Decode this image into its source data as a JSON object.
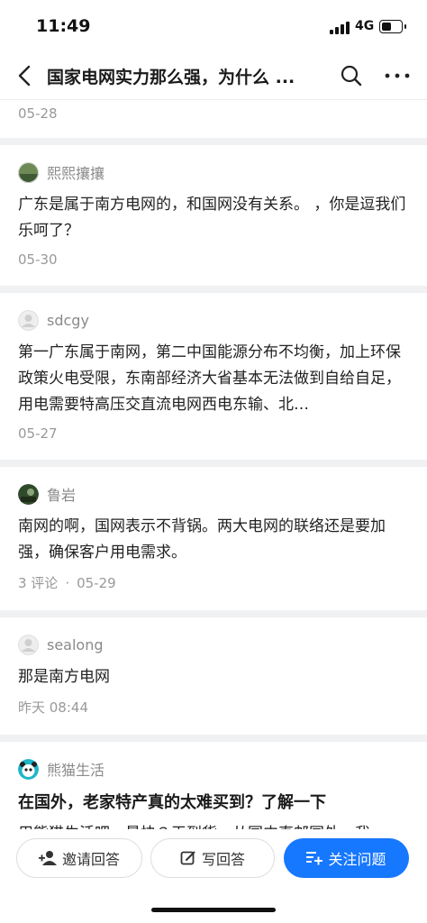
{
  "status": {
    "time": "11:49",
    "network": "4G"
  },
  "nav": {
    "title": "国家电网实力那么强，为什么 ...",
    "icons": [
      "back-arrow-icon",
      "search-icon",
      "more-dots-icon"
    ]
  },
  "answers": [
    {
      "body": "",
      "date": "05-28"
    },
    {
      "user": "熙熙攘攘",
      "body": "广东是属于南方电网的，和国网没有关系。 ，你是逗我们乐呵了？",
      "date": "05-30"
    },
    {
      "user": "sdcgy",
      "body": "第一广东属于南网，第二中国能源分布不均衡，加上环保政策火电受限，东南部经济大省基本无法做到自给自足，用电需要特高压交直流电网西电东输、北…",
      "date": "05-27"
    },
    {
      "user": "鲁岩",
      "body": "南网的啊，国网表示不背锅。两大电网的联络还是要加强，确保客户用电需求。",
      "comments": "3 评论",
      "separator": "·",
      "date": "05-29"
    },
    {
      "user": "sealong",
      "body": "那是南方电网",
      "date": "昨天 08:44"
    }
  ],
  "ad": {
    "user": "熊猫生活",
    "headline": "在国外，老家特产真的太难买到？了解一下",
    "body": "用熊猫生活吧，最快３天到货，从国内直邮国外，我"
  },
  "actions": {
    "invite": "邀请回答",
    "write": "写回答",
    "follow": "关注问题"
  },
  "colors": {
    "primary": "#1677ff",
    "meta": "#999999"
  }
}
